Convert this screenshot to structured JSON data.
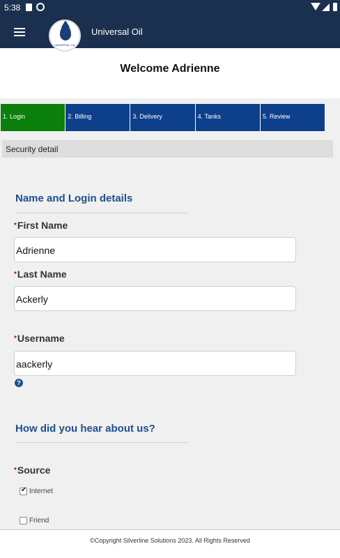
{
  "status_bar": {
    "time": "5:38",
    "icons": [
      "sim-icon",
      "sync-icon",
      "wifi-icon",
      "signal-icon",
      "battery-icon"
    ]
  },
  "app_bar": {
    "title": "Universal Oil",
    "menu_icon": "hamburger-menu-icon",
    "logo_text": "UNIVERSAL OIL"
  },
  "page": {
    "welcome": "Welcome Adrienne"
  },
  "steps": [
    {
      "label": "1. Login",
      "active": true
    },
    {
      "label": "2. Billing",
      "active": false
    },
    {
      "label": "3. Delivery",
      "active": false
    },
    {
      "label": "4. Tanks",
      "active": false
    },
    {
      "label": "5. Review",
      "active": false
    }
  ],
  "section": {
    "title": "Security detail"
  },
  "name_login": {
    "title": "Name and Login details",
    "first_name": {
      "label": "First Name",
      "value": "Adrienne"
    },
    "last_name": {
      "label": "Last Name",
      "value": "Ackerly"
    },
    "username": {
      "label": "Username",
      "value": "aackerly",
      "help": "?"
    }
  },
  "hear_about": {
    "title": "How did you hear about us?",
    "source_label": "Source",
    "options": [
      {
        "label": "Internet",
        "checked": true
      },
      {
        "label": "Friend",
        "checked": false
      }
    ]
  },
  "required_marker": "*",
  "footer": {
    "text": "©Copyright Silverline Solutions 2023. All Rights Reserved"
  },
  "colors": {
    "app_bar": "#1b2f4e",
    "step_active": "#0b7f0b",
    "step_inactive": "#0e3f8a",
    "group_title": "#1f4e8c",
    "required": "#cc0000"
  }
}
